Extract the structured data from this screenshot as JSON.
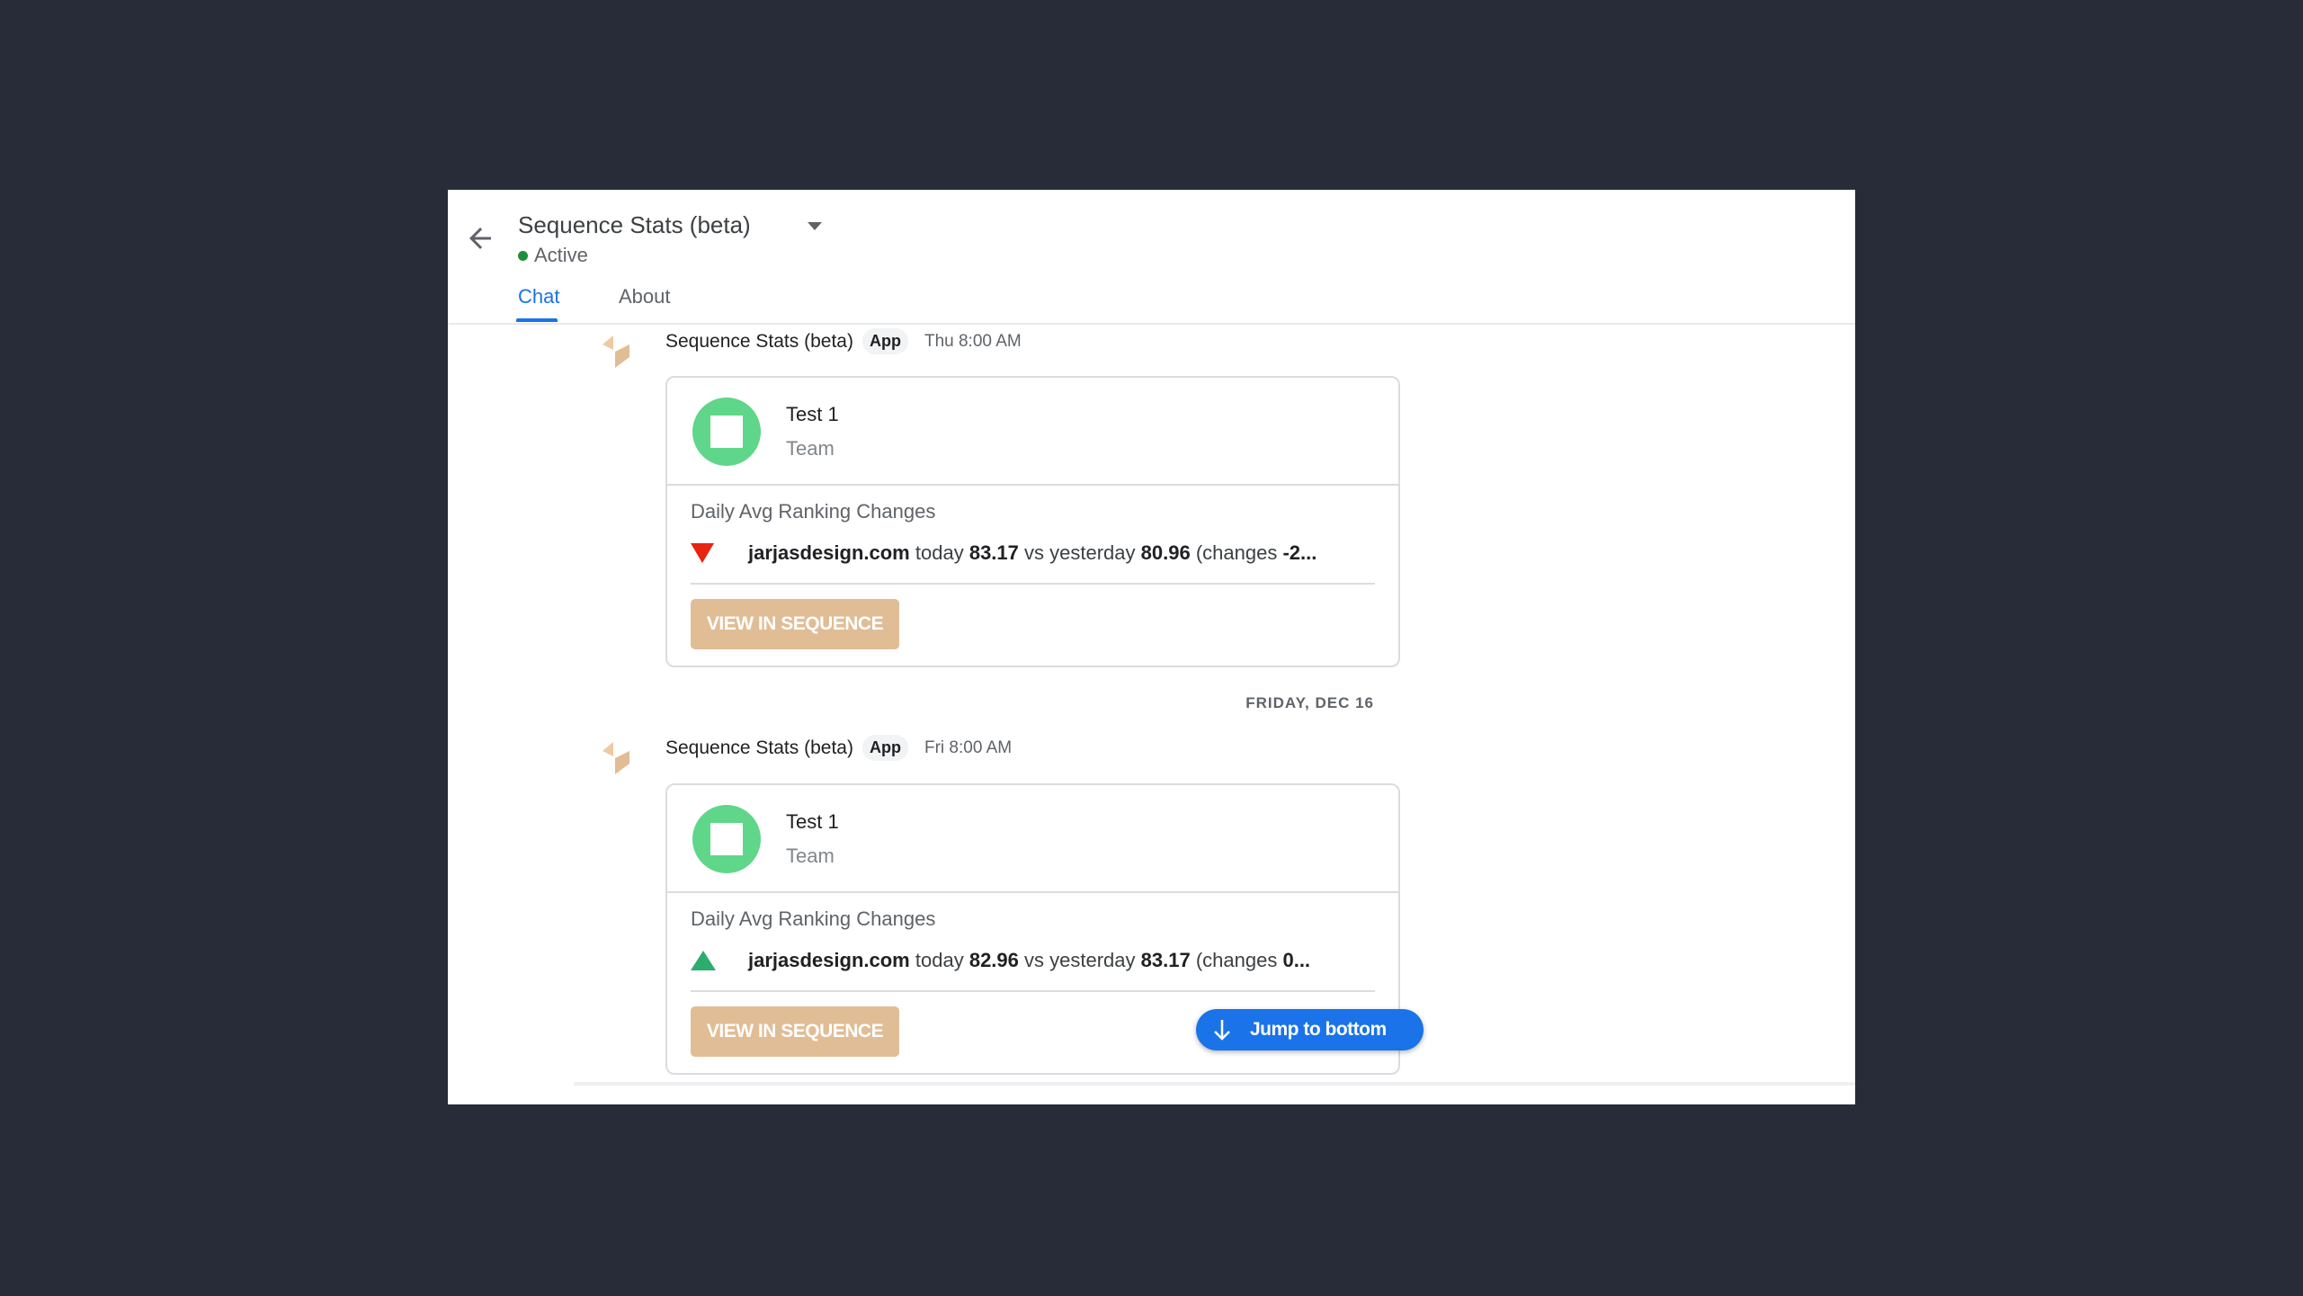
{
  "header": {
    "back_icon": "arrow-left-icon",
    "title": "Sequence Stats (beta)",
    "dropdown_icon": "caret-down-icon",
    "status": "Active",
    "status_color": "#1e8e3e"
  },
  "tabs": [
    {
      "label": "Chat",
      "active": true
    },
    {
      "label": "About",
      "active": false
    }
  ],
  "messages": [
    {
      "sender": "Sequence Stats (beta)",
      "badge": "App",
      "time": "Thu 8:00 AM",
      "card": {
        "title": "Test 1",
        "subtitle": "Team",
        "section": "Daily Avg Ranking Changes",
        "trend": "down",
        "trend_icon": "triangle-down-icon",
        "trend_color": "#e8230f",
        "domain": "jarjasdesign.com",
        "text_today": "today",
        "today": "83.17",
        "text_vs": "vs yesterday",
        "yesterday": "80.96",
        "text_changes": "(changes",
        "changes": "-2...",
        "button": "VIEW IN SEQUENCE"
      }
    },
    {
      "sender": "Sequence Stats (beta)",
      "badge": "App",
      "time": "Fri 8:00 AM",
      "card": {
        "title": "Test 1",
        "subtitle": "Team",
        "section": "Daily Avg Ranking Changes",
        "trend": "up",
        "trend_icon": "triangle-up-icon",
        "trend_color": "#2dac6e",
        "domain": "jarjasdesign.com",
        "text_today": "today",
        "today": "82.96",
        "text_vs": "vs yesterday",
        "yesterday": "83.17",
        "text_changes": "(changes",
        "changes": "0...",
        "button": "VIEW IN SEQUENCE"
      }
    }
  ],
  "date_divider": "FRIDAY, DEC 16",
  "jump_button": {
    "label": "Jump to bottom",
    "icon": "arrow-down-icon"
  },
  "colors": {
    "accent": "#1a73e8",
    "button": "#e1bd95",
    "logo": "#5fd68a"
  }
}
